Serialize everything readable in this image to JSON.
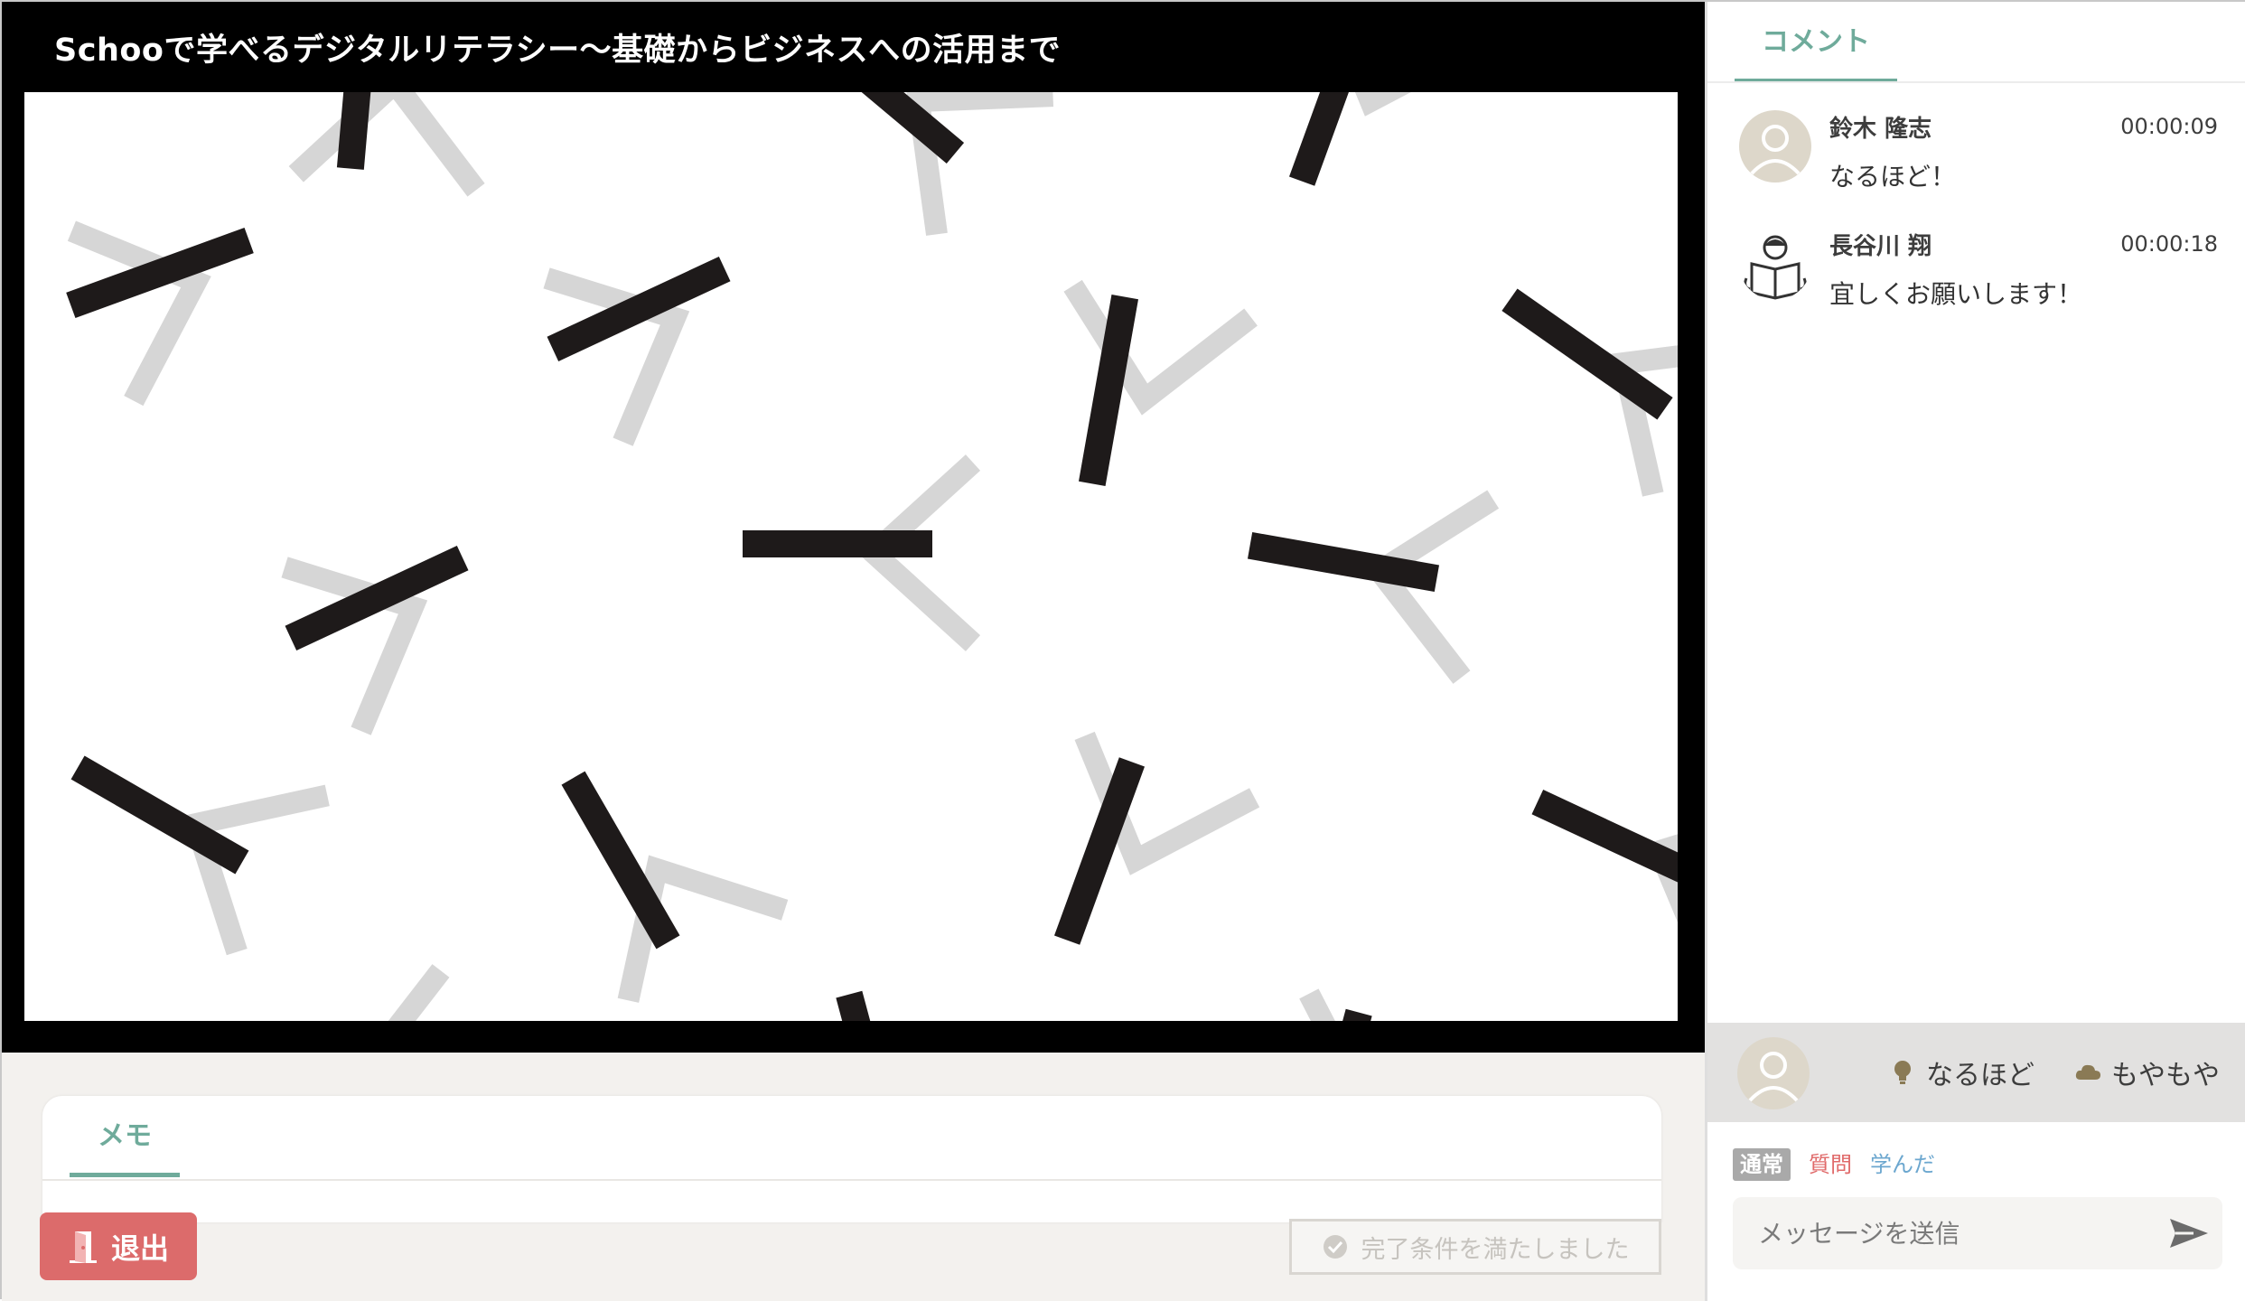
{
  "video": {
    "title": "Schooで学べるデジタルリテラシー〜基礎からビジネスへの活用まで"
  },
  "memo": {
    "tab_label": "メモ"
  },
  "footer": {
    "exit_label": "退出",
    "complete_label": "完了条件を満たしました"
  },
  "sidebar": {
    "tab_label": "コメント",
    "comments": [
      {
        "name": "鈴木 隆志",
        "time": "00:00:09",
        "text": "なるほど！"
      },
      {
        "name": "長谷川 翔",
        "time": "00:00:18",
        "text": "宜しくお願いします！"
      }
    ],
    "reactions": {
      "naruhodo": "なるほど",
      "moyamoya": "もやもや"
    },
    "modes": {
      "normal": "通常",
      "question": "質問",
      "learned": "学んだ"
    },
    "message": {
      "placeholder": "メッセージを送信"
    }
  },
  "colors": {
    "accent": "#6fab9b",
    "exit": "#dc6b6b",
    "question": "#e06a6a",
    "learned": "#6ca7cf"
  }
}
